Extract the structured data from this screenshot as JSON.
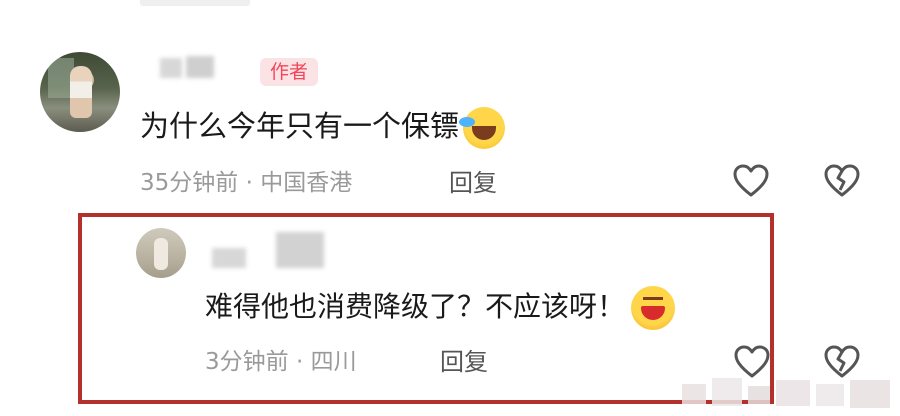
{
  "comment1": {
    "author_tag": "作者",
    "text": "为什么今年只有一个保镖",
    "emoji": "tears-of-joy",
    "meta": "35分钟前 · 中国香港",
    "reply_label": "回复"
  },
  "reply1": {
    "text": "难得他也消费降级了？不应该呀！",
    "emoji": "grinning-laugh",
    "meta": "3分钟前 · 四川",
    "reply_label": "回复"
  },
  "colors": {
    "author_tag_text": "#f2475b",
    "author_tag_bg": "#fbe3e5",
    "highlight_frame": "#b3302c",
    "meta_text": "#9a9a9a"
  },
  "icons": {
    "like": "heart-outline-icon",
    "dislike": "broken-heart-outline-icon"
  }
}
